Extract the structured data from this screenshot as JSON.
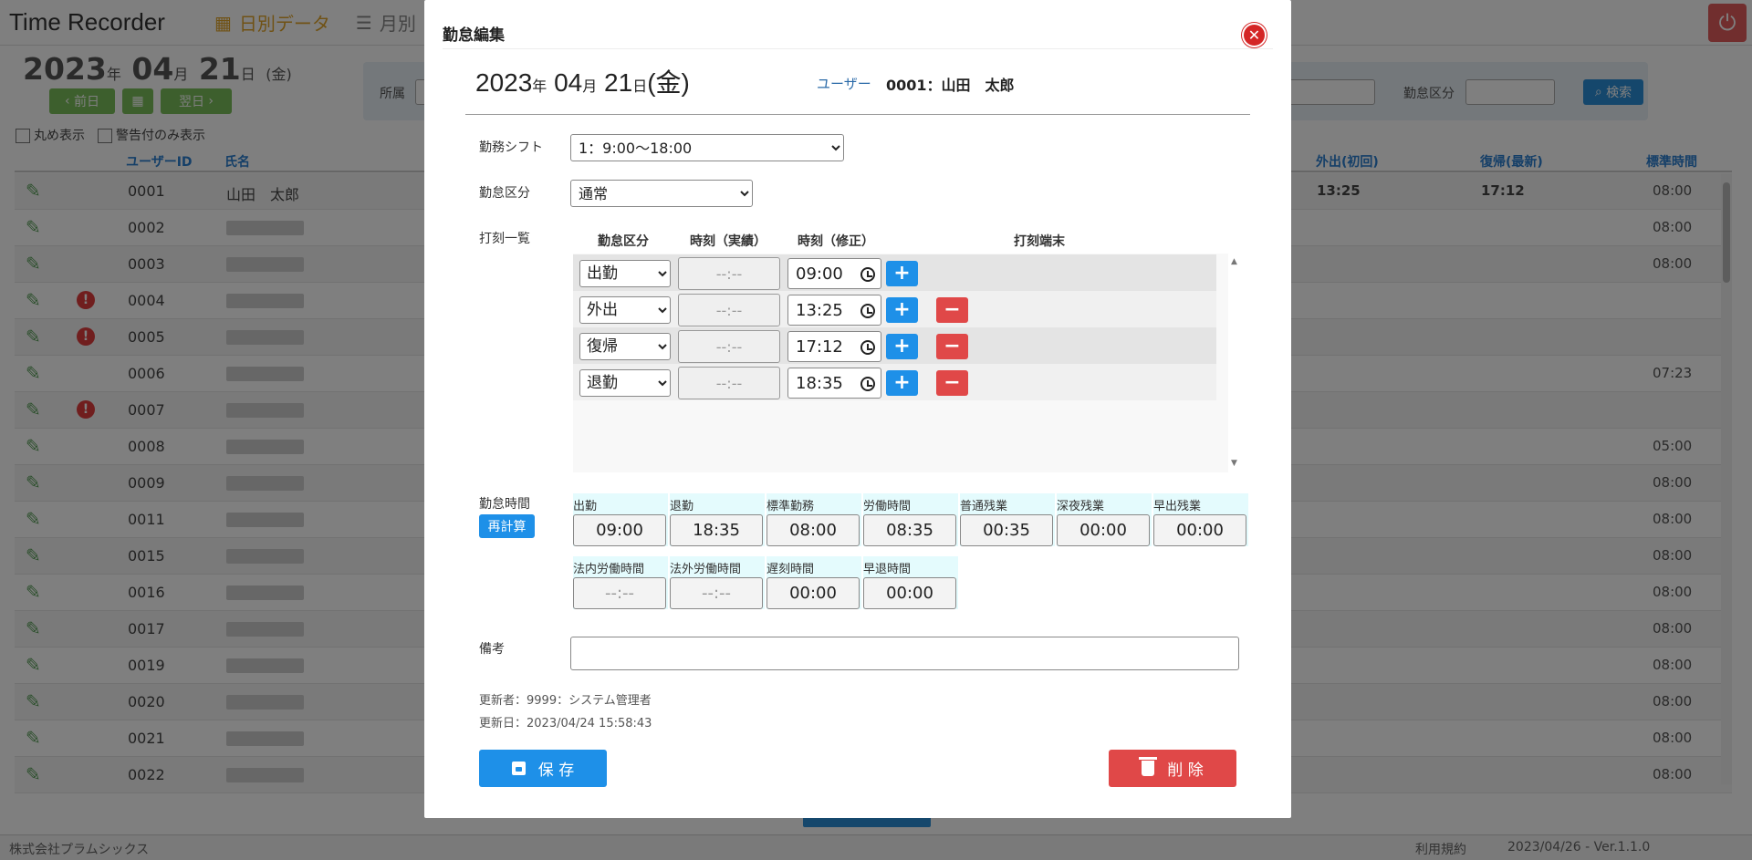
{
  "app": {
    "title": "Time Recorder",
    "nav_daily": "日別データ",
    "nav_monthly": "月別",
    "date": {
      "year": "2023",
      "year_unit": "年",
      "month": "04",
      "month_unit": "月",
      "day": "21",
      "day_unit": "日",
      "weekday": "(金)"
    },
    "prev_label": "前日",
    "next_label": "翌日",
    "filter_dept_label": "所属",
    "filter_kind_label": "勤怠区分",
    "search_label": "検索",
    "check_round": "丸め表示",
    "check_warn": "警告付のみ表示",
    "columns": {
      "user_id": "ユーザーID",
      "name": "氏名",
      "out_first": "外出(初回)",
      "return_last": "復帰(最新)",
      "standard": "標準時間"
    },
    "rows": [
      {
        "id": "0001",
        "name": "山田　太郎",
        "warn": false,
        "out": "13:25",
        "ret": "17:12",
        "std": "08:00"
      },
      {
        "id": "0002",
        "name": "",
        "warn": false,
        "out": "",
        "ret": "",
        "std": "08:00"
      },
      {
        "id": "0003",
        "name": "",
        "warn": false,
        "out": "",
        "ret": "",
        "std": "08:00"
      },
      {
        "id": "0004",
        "name": "",
        "warn": true,
        "out": "",
        "ret": "",
        "std": ""
      },
      {
        "id": "0005",
        "name": "",
        "warn": true,
        "out": "",
        "ret": "",
        "std": ""
      },
      {
        "id": "0006",
        "name": "",
        "warn": false,
        "out": "",
        "ret": "",
        "std": "07:23"
      },
      {
        "id": "0007",
        "name": "",
        "warn": true,
        "out": "",
        "ret": "",
        "std": ""
      },
      {
        "id": "0008",
        "name": "",
        "warn": false,
        "out": "",
        "ret": "",
        "std": "05:00"
      },
      {
        "id": "0009",
        "name": "",
        "warn": false,
        "out": "",
        "ret": "",
        "std": "08:00"
      },
      {
        "id": "0011",
        "name": "",
        "warn": false,
        "out": "",
        "ret": "",
        "std": "08:00"
      },
      {
        "id": "0015",
        "name": "",
        "warn": false,
        "out": "",
        "ret": "",
        "std": "08:00"
      },
      {
        "id": "0016",
        "name": "",
        "warn": false,
        "out": "",
        "ret": "",
        "std": "08:00"
      },
      {
        "id": "0017",
        "name": "",
        "warn": false,
        "out": "",
        "ret": "",
        "std": "08:00"
      },
      {
        "id": "0019",
        "name": "",
        "warn": false,
        "out": "",
        "ret": "",
        "std": "08:00"
      },
      {
        "id": "0020",
        "name": "",
        "warn": false,
        "out": "",
        "ret": "",
        "std": "08:00"
      },
      {
        "id": "0021",
        "name": "",
        "warn": false,
        "out": "",
        "ret": "",
        "std": "08:00"
      },
      {
        "id": "0022",
        "name": "",
        "warn": false,
        "out": "",
        "ret": "",
        "std": "08:00"
      }
    ],
    "footer_company": "株式会社プラムシックス",
    "footer_terms": "利用規約",
    "footer_version": "2023/04/26 - Ver.1.1.0"
  },
  "modal": {
    "title": "勤怠編集",
    "date": {
      "year": "2023",
      "year_unit": "年",
      "month": "04",
      "month_unit": "月",
      "day": "21",
      "day_unit": "日",
      "weekday": "(金)"
    },
    "user_label": "ユーザー",
    "user_value": "0001：山田　太郎",
    "shift_label": "勤務シフト",
    "shift_value": "1：9:00〜18:00",
    "kind_label": "勤怠区分",
    "kind_value": "通常",
    "stamp_label": "打刻一覧",
    "stamp_headers": {
      "kind": "勤怠区分",
      "actual": "時刻（実績）",
      "fixed": "時刻（修正）",
      "terminal": "打刻端末"
    },
    "stamps": [
      {
        "kind": "出勤",
        "actual": "--:--",
        "fixed": "09:00",
        "removable": false
      },
      {
        "kind": "外出",
        "actual": "--:--",
        "fixed": "13:25",
        "removable": true
      },
      {
        "kind": "復帰",
        "actual": "--:--",
        "fixed": "17:12",
        "removable": true
      },
      {
        "kind": "退勤",
        "actual": "--:--",
        "fixed": "18:35",
        "removable": true
      }
    ],
    "times_label": "勤怠時間",
    "recalc_label": "再計算",
    "times": [
      {
        "label": "出勤",
        "value": "09:00"
      },
      {
        "label": "退勤",
        "value": "18:35"
      },
      {
        "label": "標準勤務",
        "value": "08:00"
      },
      {
        "label": "労働時間",
        "value": "08:35"
      },
      {
        "label": "普通残業",
        "value": "00:35"
      },
      {
        "label": "深夜残業",
        "value": "00:00"
      },
      {
        "label": "早出残業",
        "value": "00:00"
      },
      {
        "label": "法内労働時間",
        "value": "--:--"
      },
      {
        "label": "法外労働時間",
        "value": "--:--"
      },
      {
        "label": "遅刻時間",
        "value": "00:00"
      },
      {
        "label": "早退時間",
        "value": "00:00"
      }
    ],
    "memo_label": "備考",
    "memo_value": "",
    "updated_by": "更新者：9999：システム管理者",
    "updated_at": "更新日：2023/04/24 15:58:43",
    "save_label": "保 存",
    "delete_label": "削 除"
  },
  "colors": {
    "primary": "#1e90e8",
    "danger": "#e04848",
    "header_accent": "#e0a52a",
    "time_cell_bg": "#e4fbfd"
  }
}
